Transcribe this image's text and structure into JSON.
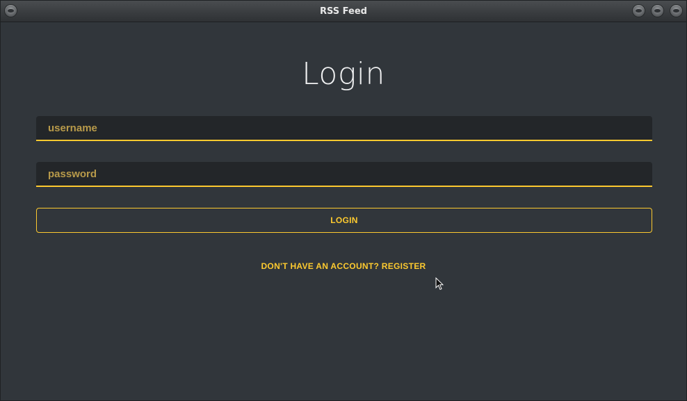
{
  "window": {
    "title": "RSS Feed"
  },
  "login": {
    "heading": "Login",
    "username_placeholder": "username",
    "username_value": "",
    "password_placeholder": "password",
    "password_value": "",
    "login_button_label": "LOGIN",
    "register_link_label": "DON'T HAVE AN ACCOUNT? REGISTER"
  },
  "theme": {
    "background": "#31363b",
    "field_background": "#232629",
    "accent": "#fdca2f",
    "heading_color": "#eff0f1"
  },
  "icons": {
    "window_menu": "circle-button-icon",
    "minimize": "circle-button-icon",
    "maximize": "circle-button-icon",
    "close": "circle-button-icon",
    "pointer": "mouse-pointer-icon"
  }
}
